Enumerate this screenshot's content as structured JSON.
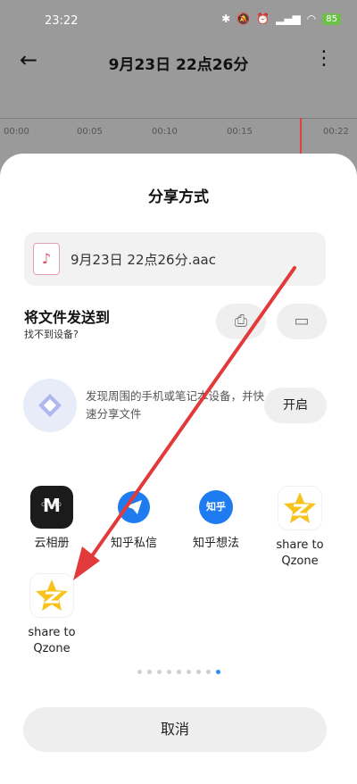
{
  "status_bar": {
    "time": "23:22",
    "battery": "85"
  },
  "recorder": {
    "title": "9月23日 22点26分",
    "timeline_ticks": [
      "00:00",
      "00:05",
      "00:10",
      "00:15",
      "00:22"
    ]
  },
  "share_sheet": {
    "title": "分享方式",
    "file_name": "9月23日 22点26分.aac",
    "send_section": {
      "title": "将文件发送到",
      "subtitle": "找不到设备?"
    },
    "nearby": {
      "text": "发现周围的手机或笔记本设备，并快速分享文件",
      "enable_label": "开启"
    },
    "apps": [
      {
        "label": "云相册",
        "icon": "cloud-album-icon"
      },
      {
        "label": "知乎私信",
        "icon": "zhihu-message-icon"
      },
      {
        "label": "知乎想法",
        "icon": "zhihu-idea-icon"
      },
      {
        "label": "share to Qzone",
        "icon": "qzone-icon"
      },
      {
        "label": "share to Qzone",
        "icon": "qzone-icon"
      }
    ],
    "icon_text": {
      "zhihu": "知乎"
    },
    "pagination": {
      "count": 9,
      "active_index": 8
    },
    "cancel_label": "取消"
  },
  "colors": {
    "accent": "#2a8cf0",
    "annotation_arrow": "#e23a3a"
  }
}
